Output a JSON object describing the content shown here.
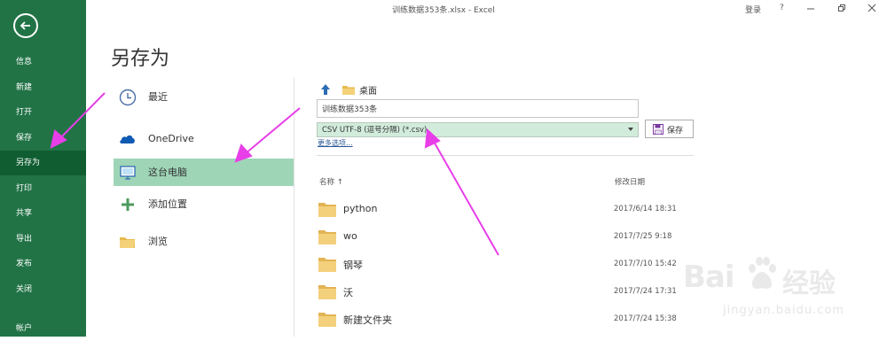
{
  "window": {
    "title": "训练数据353条.xlsx - Excel",
    "signin_label": "登录",
    "help_label": "?"
  },
  "sidebar": {
    "items": [
      {
        "label": "信息"
      },
      {
        "label": "新建"
      },
      {
        "label": "打开"
      },
      {
        "label": "保存"
      },
      {
        "label": "另存为",
        "selected": true
      },
      {
        "label": "打印"
      },
      {
        "label": "共享"
      },
      {
        "label": "导出"
      },
      {
        "label": "发布"
      },
      {
        "label": "关闭"
      },
      {
        "label": "帐户"
      }
    ]
  },
  "page": {
    "heading": "另存为"
  },
  "locations": [
    {
      "label": "最近",
      "icon": "clock-icon"
    },
    {
      "label": "OneDrive",
      "icon": "cloud-icon"
    },
    {
      "label": "这台电脑",
      "icon": "computer-icon",
      "selected": true
    },
    {
      "label": "添加位置",
      "icon": "plus-icon"
    },
    {
      "label": "浏览",
      "icon": "folder-icon"
    }
  ],
  "save_panel": {
    "current_path": "桌面",
    "filename_value": "训练数据353条",
    "filetype_value": "CSV UTF-8 (逗号分隔) (*.csv)",
    "more_options_label": "更多选项...",
    "save_button_label": "保存",
    "column_name": "名称 ↑",
    "column_date": "修改日期",
    "files": [
      {
        "name": "python",
        "date": "2017/6/14 18:31"
      },
      {
        "name": "wo",
        "date": "2017/7/25 9:18"
      },
      {
        "name": "钢琴",
        "date": "2017/7/10 15:42"
      },
      {
        "name": "沃",
        "date": "2017/7/24 17:31"
      },
      {
        "name": "新建文件夹",
        "date": "2017/7/24 15:38"
      }
    ]
  },
  "watermark": {
    "brand": "Bai",
    "brand_cn": "经验",
    "url": "jingyan.baidu.com"
  },
  "colors": {
    "sidebar": "#217346",
    "sidebar_selected": "#0f5d31",
    "location_selected": "#9fd5b7",
    "filetype_bg": "#d2ecdc",
    "annotation_arrow": "#e83ee8",
    "folder": "#f0c36a"
  }
}
